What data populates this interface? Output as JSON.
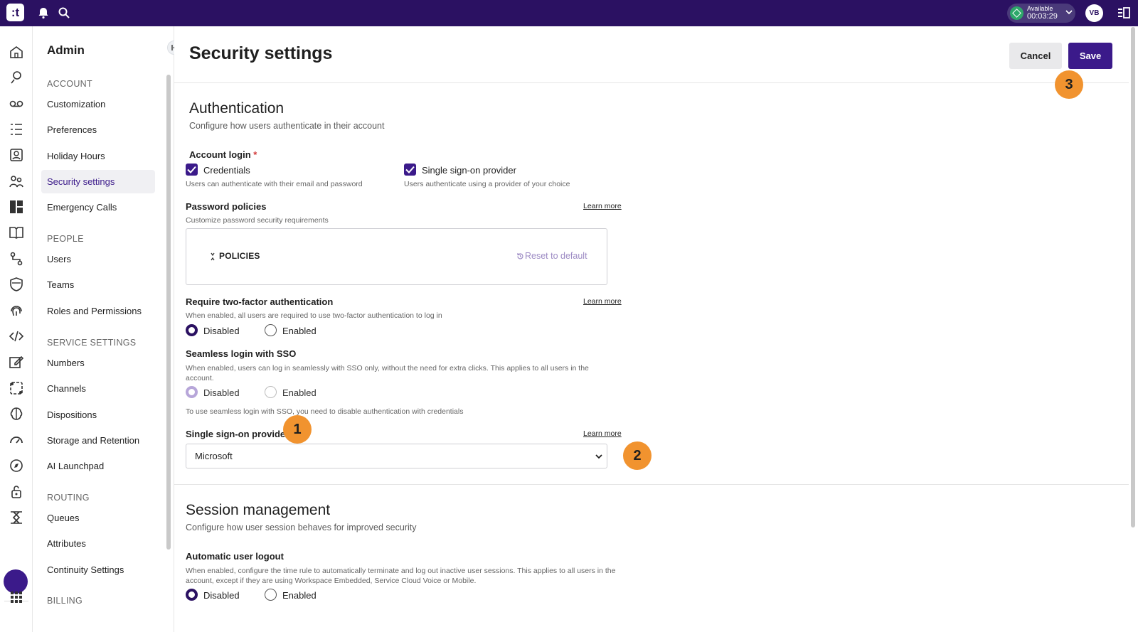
{
  "topbar": {
    "logo": ":t",
    "icons": [
      "bell-icon",
      "search-icon"
    ],
    "status": {
      "label": "Available",
      "time": "00:03:29",
      "color": "#2ea86a"
    },
    "avatar": "VB",
    "panel_icon": "panel-toggle-icon"
  },
  "rail": {
    "icons": [
      "home-icon",
      "conversation-icon",
      "voicemail-icon",
      "list-icon",
      "contacts-icon",
      "people-icon",
      "dashboard-icon",
      "book-icon",
      "flow-icon",
      "shield-icon",
      "fingerprint-icon",
      "code-icon",
      "edit-icon",
      "automation-icon",
      "brain-icon",
      "gauge-icon",
      "compass-icon",
      "security-icon",
      "agent-icon",
      "settings-icon",
      "apps-grid-icon"
    ]
  },
  "sidebar": {
    "title": "Admin",
    "sections": [
      {
        "heading": "ACCOUNT",
        "items": [
          "Customization",
          "Preferences",
          "Holiday Hours",
          "Security settings",
          "Emergency Calls"
        ]
      },
      {
        "heading": "PEOPLE",
        "items": [
          "Users",
          "Teams",
          "Roles and Permissions"
        ]
      },
      {
        "heading": "SERVICE SETTINGS",
        "items": [
          "Numbers",
          "Channels",
          "Dispositions",
          "Storage and Retention",
          "AI Launchpad"
        ]
      },
      {
        "heading": "ROUTING",
        "items": [
          "Queues",
          "Attributes",
          "Continuity Settings"
        ]
      },
      {
        "heading": "BILLING",
        "items": []
      }
    ],
    "active_item": "Security settings"
  },
  "header": {
    "title": "Security settings",
    "cancel_label": "Cancel",
    "save_label": "Save"
  },
  "authentication": {
    "title": "Authentication",
    "subtitle": "Configure how users authenticate in their account",
    "account_login": {
      "label": "Account login",
      "required_mark": "*",
      "options": [
        {
          "label": "Credentials",
          "help": "Users can authenticate with their email and password",
          "checked": true
        },
        {
          "label": "Single sign-on provider",
          "help": "Users authenticate using a provider of your choice",
          "checked": true
        }
      ]
    },
    "password_policies": {
      "label": "Password policies",
      "help": "Customize password security requirements",
      "learn_more": "Learn more",
      "box_title": "POLICIES",
      "reset_label": "Reset to default"
    },
    "two_factor": {
      "label": "Require two-factor authentication",
      "help": "When enabled, all users are required to use two-factor authentication to log in",
      "learn_more": "Learn more",
      "options": [
        "Disabled",
        "Enabled"
      ],
      "selected": "Disabled"
    },
    "seamless_sso": {
      "label": "Seamless login with SSO",
      "help": "When enabled, users can log in seamlessly with SSO only, without the need for extra clicks. This applies to all users in the account.",
      "options": [
        "Disabled",
        "Enabled"
      ],
      "selected": "Disabled",
      "note": "To use seamless login with SSO, you need to disable authentication with credentials"
    },
    "sso_provider": {
      "label": "Single sign-on provider",
      "learn_more": "Learn more",
      "value": "Microsoft"
    }
  },
  "session": {
    "title": "Session management",
    "subtitle": "Configure how user session behaves for improved security",
    "auto_logout": {
      "label": "Automatic user logout",
      "help": "When enabled, configure the time rule to automatically terminate and log out inactive user sessions. This applies to all users in the account, except if they are using Workspace Embedded, Service Cloud Voice or Mobile.",
      "options": [
        "Disabled",
        "Enabled"
      ],
      "selected": "Disabled"
    }
  },
  "annotations": {
    "badges": [
      "1",
      "2",
      "3"
    ],
    "color": "#f1932f"
  },
  "colors": {
    "brand": "#2b1162",
    "accent": "#3b1a8a"
  }
}
